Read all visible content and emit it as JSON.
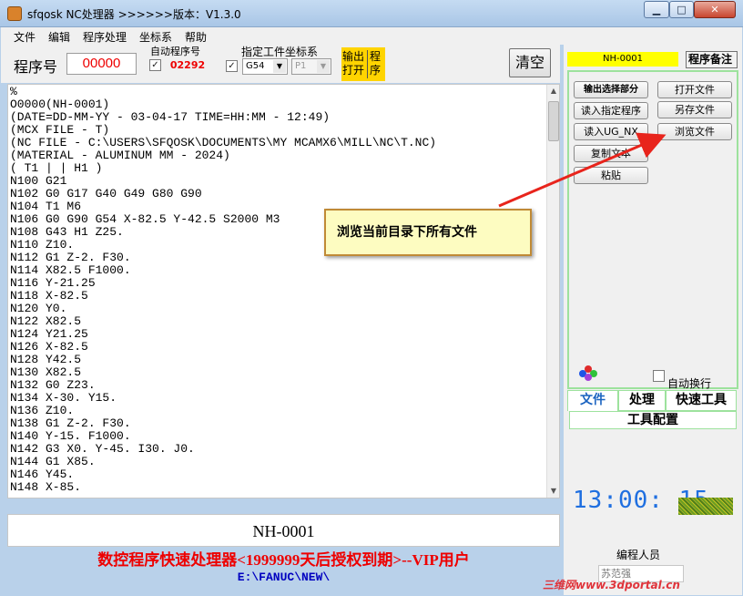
{
  "window": {
    "title": "sfqosk NC处理器 >>>>>>版本：V1.3.0"
  },
  "menu": [
    "文件",
    "编辑",
    "程序处理",
    "坐标系",
    "帮助"
  ],
  "toolbar": {
    "program_label": "程序号",
    "program_number": "00000",
    "auto_label": "自动程序号",
    "auto_number": "02292",
    "coord_label": "指定工件坐标系",
    "coord_value": "G54",
    "p_value": "P1",
    "output_lines": [
      "输出",
      "打开"
    ],
    "program_lines": [
      "程",
      "序"
    ],
    "clear_label": "清空"
  },
  "code_lines": [
    "%",
    "O0000(NH-0001)",
    "(DATE=DD-MM-YY - 03-04-17 TIME=HH:MM - 12:49)",
    "(MCX FILE - T)",
    "(NC FILE - C:\\USERS\\SFQOSK\\DOCUMENTS\\MY MCAMX6\\MILL\\NC\\T.NC)",
    "(MATERIAL - ALUMINUM MM - 2024)",
    "( T1 | | H1 )",
    "N100 G21",
    "N102 G0 G17 G40 G49 G80 G90",
    "N104 T1 M6",
    "N106 G0 G90 G54 X-82.5 Y-42.5 S2000 M3",
    "N108 G43 H1 Z25.",
    "N110 Z10.",
    "N112 G1 Z-2. F30.",
    "N114 X82.5 F1000.",
    "N116 Y-21.25",
    "N118 X-82.5",
    "N120 Y0.",
    "N122 X82.5",
    "N124 Y21.25",
    "N126 X-82.5",
    "N128 Y42.5",
    "N130 X82.5",
    "N132 G0 Z23.",
    "N134 X-30. Y15.",
    "N136 Z10.",
    "N138 G1 Z-2. F30.",
    "N140 Y-15. F1000.",
    "N142 G3 X0. Y-45. I30. J0.",
    "N144 G1 X85.",
    "N146 Y45.",
    "N148 X-85."
  ],
  "program_name": "NH-0001",
  "banner": "数控程序快速处理器<1999999天后授权到期>--VIP用户",
  "path": "E:\\FANUC\\NEW\\",
  "right_panel": {
    "program_id": "NH-0001",
    "memo_label": "程序备注",
    "buttons": {
      "output_selection": "输出选择部分",
      "open_file": "打开文件",
      "read_program": "读入指定程序",
      "save_as": "另存文件",
      "read_ug": "读入UG_NX",
      "browse": "浏览文件",
      "copy_text": "复制文本",
      "paste": "粘贴"
    },
    "auto_wrap": "自动换行",
    "tabs": [
      "文件",
      "处理",
      "快速工具"
    ],
    "tool_config": "工具配置",
    "clock": "13:00: 15",
    "coder_label": "编程人员",
    "coder_value": "苏范强"
  },
  "tooltip": "浏览当前目录下所有文件",
  "watermark": "三维网www.3dportal.cn",
  "colors": {
    "accent_red": "#e00000",
    "highlight_yellow": "#ffff00",
    "clock_blue": "#1f6fe0",
    "tab_green": "#9de29d"
  }
}
